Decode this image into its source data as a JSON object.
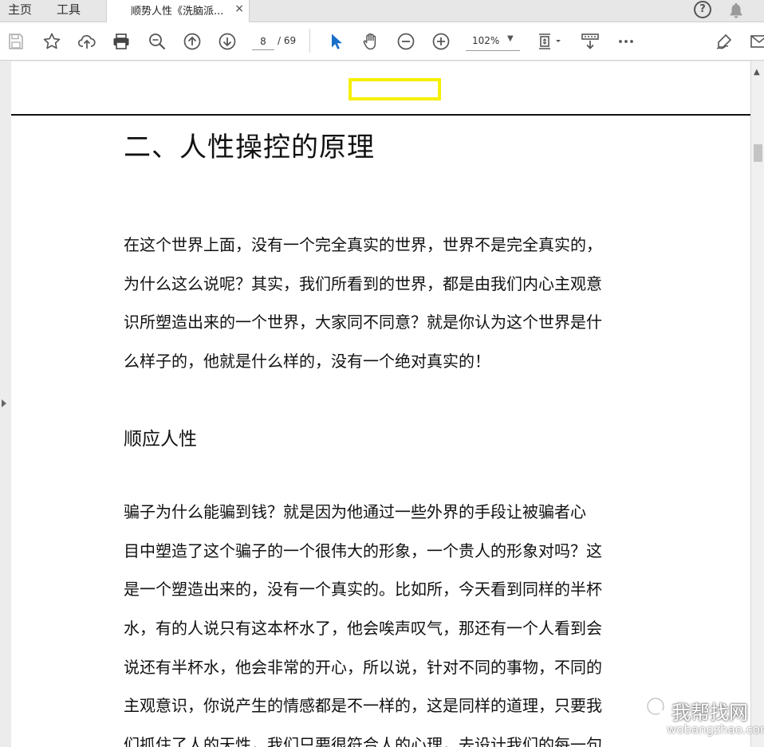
{
  "tabs": {
    "home": "主页",
    "tools": "工具",
    "document": "顺势人性《洗脑派...",
    "close": "×"
  },
  "toolbar": {
    "page_current": "8",
    "page_total": "/ 69",
    "zoom": "102%"
  },
  "icons": {
    "save": "save-icon",
    "bookmark": "star-icon",
    "upload": "cloud-upload-icon",
    "print": "printer-icon",
    "search": "zoom-search-icon",
    "prev": "arrow-up-circle-icon",
    "next": "arrow-down-circle-icon",
    "select": "cursor-arrow-icon",
    "hand": "hand-icon",
    "zoom_out": "minus-circle-icon",
    "zoom_in": "plus-circle-icon",
    "fit": "fit-page-icon",
    "scroll_mode": "scroll-mode-icon",
    "more": "more-icon",
    "sign": "sign-icon",
    "mail": "mail-icon",
    "help": "help-icon",
    "notifications": "bell-icon"
  },
  "document": {
    "title": "二、人性操控的原理",
    "para1": [
      "在这个世界上面，没有一个完全真实的世界，世界不是完全真实的，",
      "为什么这么说呢？其实，我们所看到的世界，都是由我们内心主观意",
      "识所塑造出来的一个世界，大家同不同意？就是你认为这个世界是什",
      "么样子的，他就是什么样的，没有一个绝对真实的！"
    ],
    "subheading": "顺应人性",
    "para2": [
      "骗子为什么能骗到钱？就是因为他通过一些外界的手段让被骗者心",
      "目中塑造了这个骗子的一个很伟大的形象，一个贵人的形象对吗？这",
      "是一个塑造出来的，没有一个真实的。比如所，今天看到同样的半杯",
      "水，有的人说只有这本杯水了，他会唉声叹气，那还有一个人看到会",
      "说还有半杯水，他会非常的开心，所以说，针对不同的事物，不同的",
      "主观意识，你说产生的情感都是不一样的，这是同样的道理，只要我",
      "们抓住了人的天性，我们只要很符合人的心理，去设计我们的每一句"
    ]
  },
  "watermark": {
    "cn": "我帮找网",
    "en": "wobangzhao.com"
  },
  "colors": {
    "highlight": "#f5f000",
    "select_tool": "#1a6fc9"
  }
}
